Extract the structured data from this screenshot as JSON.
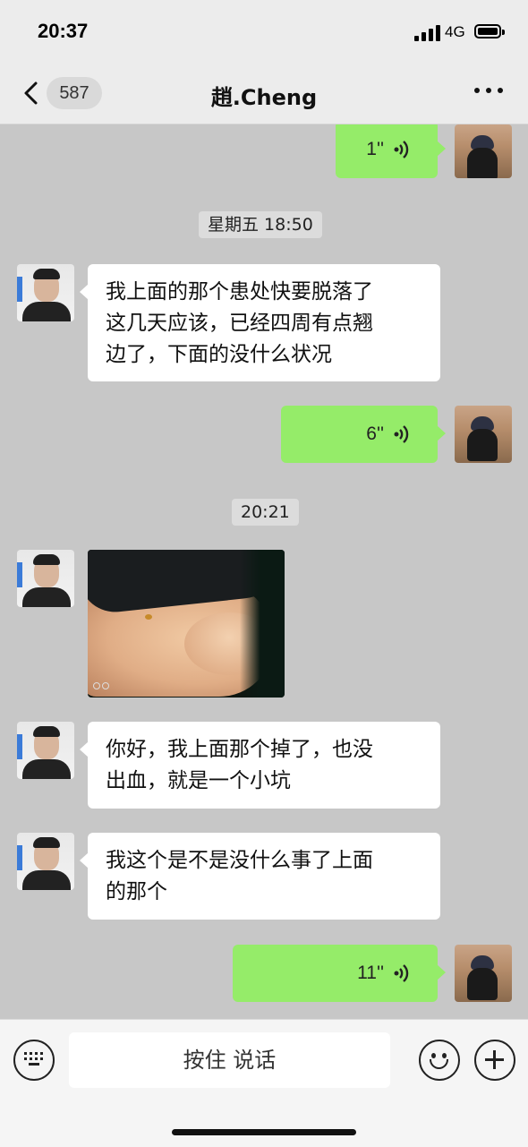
{
  "status_bar": {
    "time": "20:37",
    "network": "4G"
  },
  "nav": {
    "back_count": "587",
    "title": "趙.Cheng",
    "back_icon": "chevron-left-icon",
    "more_icon": "more-dots-icon"
  },
  "messages": [
    {
      "type": "voice",
      "side": "right",
      "duration": "1''"
    },
    {
      "type": "time",
      "text": "星期五 18:50"
    },
    {
      "type": "text",
      "side": "left",
      "text": "我上面的那个患处快要脱落了\n这几天应该，已经四周有点翘\n边了，下面的没什么状况"
    },
    {
      "type": "voice",
      "side": "right",
      "duration": "6''"
    },
    {
      "type": "time",
      "text": "20:21"
    },
    {
      "type": "image",
      "side": "left"
    },
    {
      "type": "text",
      "side": "left",
      "text": "你好，我上面那个掉了，也没\n出血，就是一个小坑"
    },
    {
      "type": "text",
      "side": "left",
      "text": "我这个是不是没什么事了上面\n的那个"
    },
    {
      "type": "voice",
      "side": "right",
      "duration": "11''"
    }
  ],
  "input_bar": {
    "hold_to_talk": "按住 说话",
    "keyboard_icon": "keyboard-icon",
    "emoji_icon": "emoji-icon",
    "plus_icon": "plus-icon"
  },
  "colors": {
    "chat_background": "#c7c7c7",
    "outgoing_bubble": "#95ec69",
    "incoming_bubble": "#ffffff"
  }
}
